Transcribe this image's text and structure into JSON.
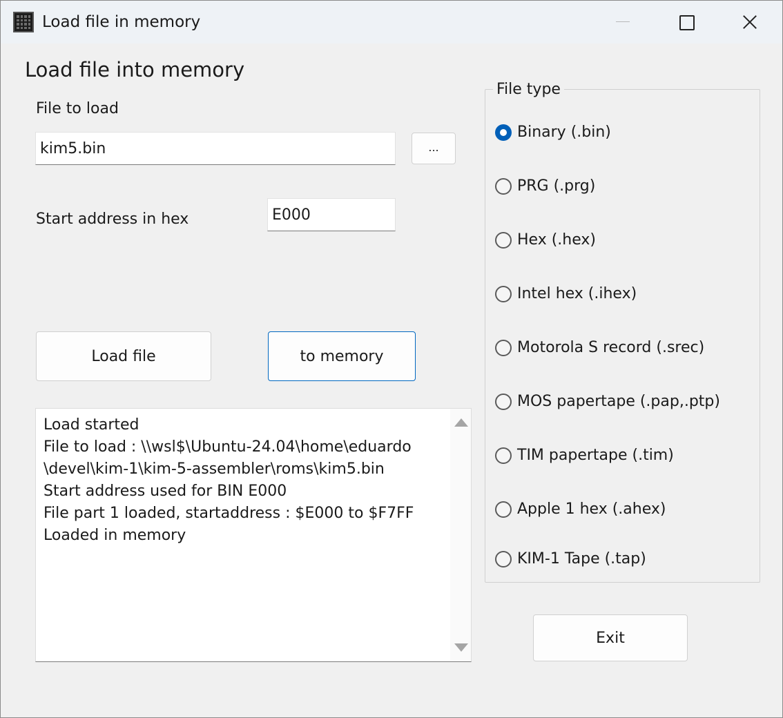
{
  "window": {
    "title": "Load file in memory"
  },
  "main": {
    "heading": "Load file into memory",
    "file_label": "File to load",
    "file_value": "kim5.bin",
    "browse_label": "...",
    "start_label": "Start address in hex",
    "start_value": "E000",
    "load_button": "Load file",
    "memory_button": "to memory"
  },
  "log": {
    "lines": [
      "Load started",
      "File to load : \\\\wsl$\\Ubuntu-24.04\\home\\eduardo",
      "\\devel\\kim-1\\kim-5-assembler\\roms\\kim5.bin",
      "Start address used for BIN E000",
      "File part 1 loaded, startaddress : $E000 to $F7FF",
      "Loaded in memory"
    ]
  },
  "file_type": {
    "title": "File type",
    "selected": "Binary (.bin)",
    "options": [
      {
        "label": "Binary (.bin)",
        "checked": true
      },
      {
        "label": "PRG (.prg)",
        "checked": false
      },
      {
        "label": "Hex (.hex)",
        "checked": false
      },
      {
        "label": "Intel hex (.ihex)",
        "checked": false
      },
      {
        "label": "Motorola S record (.srec)",
        "checked": false
      },
      {
        "label": "MOS papertape (.pap,.ptp)",
        "checked": false
      },
      {
        "label": "TIM papertape (.tim)",
        "checked": false
      },
      {
        "label": "Apple 1 hex (.ahex)",
        "checked": false
      },
      {
        "label": "KIM-1 Tape (.tap)",
        "checked": false
      }
    ]
  },
  "exit_button": "Exit",
  "colors": {
    "accent": "#005fb8",
    "window_bg": "#f0f0f0"
  }
}
